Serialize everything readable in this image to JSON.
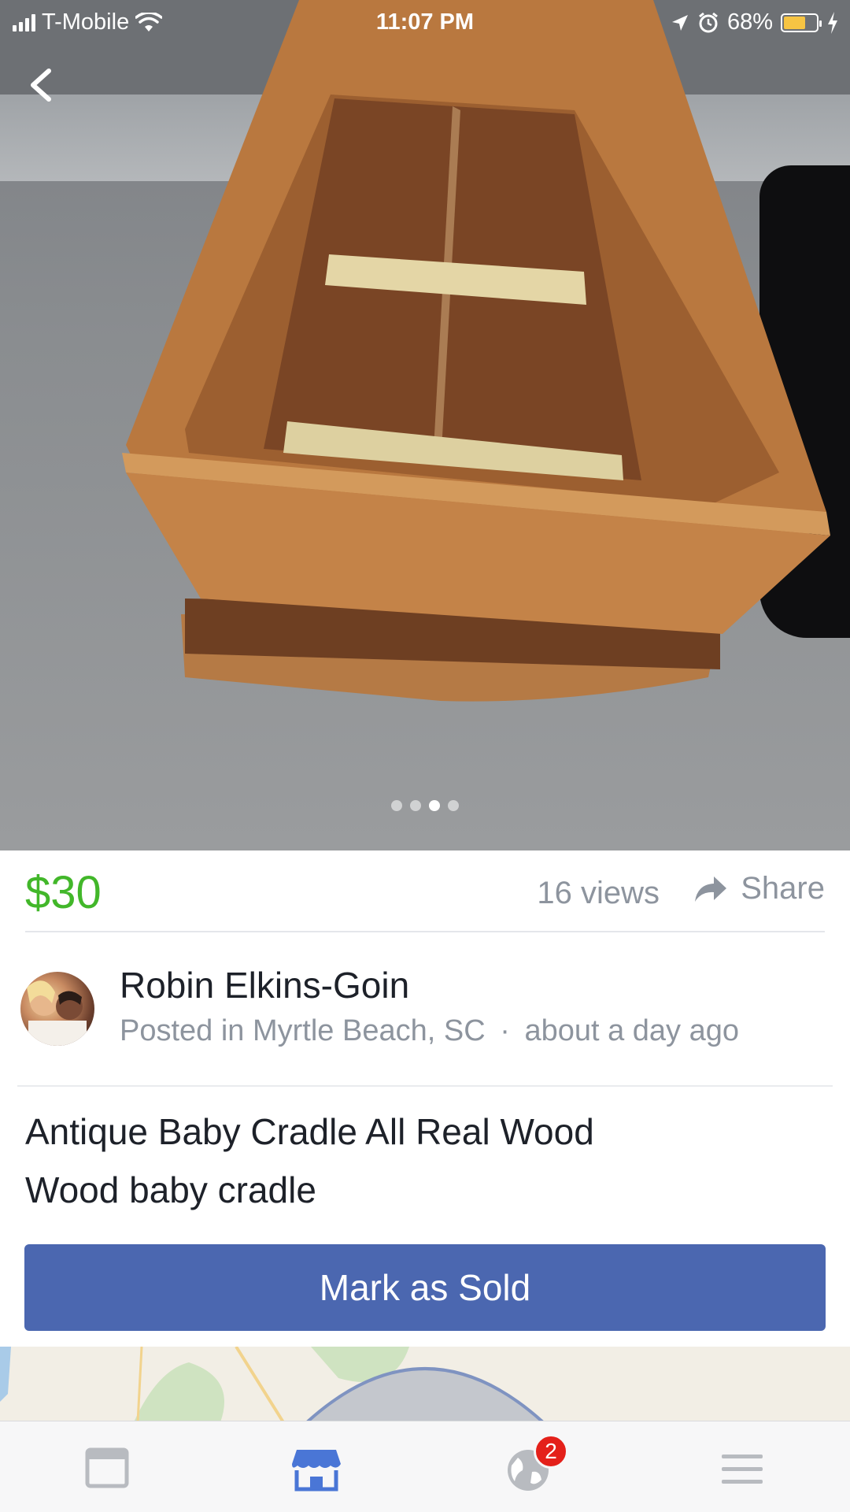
{
  "status_bar": {
    "carrier": "T-Mobile",
    "time": "11:07 PM",
    "battery": "68%",
    "battery_level": 0.68,
    "battery_color": "#f6c443"
  },
  "gallery": {
    "image_count": 4,
    "active_index": 2
  },
  "listing": {
    "price": "$30",
    "views": "16 views",
    "share_label": "Share",
    "title": "Antique Baby Cradle All Real Wood",
    "description": "Wood baby cradle",
    "mark_sold_label": "Mark as Sold"
  },
  "seller": {
    "name": "Robin Elkins-Goin",
    "location": "Posted in Myrtle Beach, SC",
    "separator": "·",
    "posted": "about a day ago"
  },
  "tabbar": {
    "items": [
      {
        "icon": "news-feed-icon",
        "active": false
      },
      {
        "icon": "marketplace-icon",
        "active": true
      },
      {
        "icon": "globe-icon",
        "active": false,
        "badge": "2"
      },
      {
        "icon": "menu-icon",
        "active": false
      }
    ]
  },
  "colors": {
    "price": "#42b72a",
    "button": "#4b67b0",
    "active_tab": "#4a76d6",
    "inactive_tab": "#b8bbc0",
    "badge": "#e4201a"
  }
}
